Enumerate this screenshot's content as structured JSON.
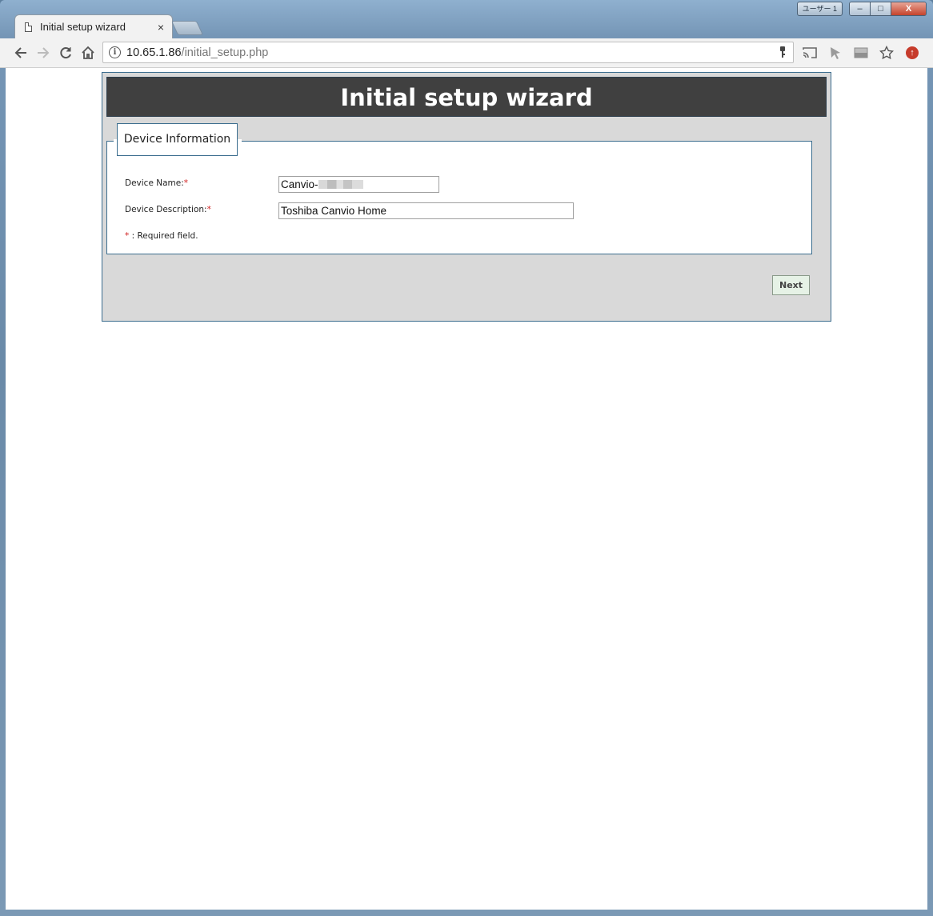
{
  "window": {
    "profile_label": "ユーザー 1",
    "minimize_glyph": "–",
    "maximize_glyph": "□",
    "close_glyph": "X"
  },
  "tab": {
    "title": "Initial setup wizard",
    "close_glyph": "×"
  },
  "toolbar": {
    "url_host": "10.65.1.86",
    "url_path": "/initial_setup.php"
  },
  "wizard": {
    "title": "Initial setup wizard",
    "section_title": "Device Information",
    "device_name_label": "Device Name:",
    "device_name_value_visible": "Canvio-",
    "device_description_label": "Device Description:",
    "device_description_value": "Toshiba Canvio Home",
    "required_marker": "*",
    "required_note": " : Required field.",
    "next_label": "Next"
  },
  "colors": {
    "header_bg": "#404040",
    "panel_bg": "#d9d9d9",
    "border_accent": "#3c6e8f",
    "required_red": "#d02020",
    "next_button_bg": "#e6f2e6"
  }
}
